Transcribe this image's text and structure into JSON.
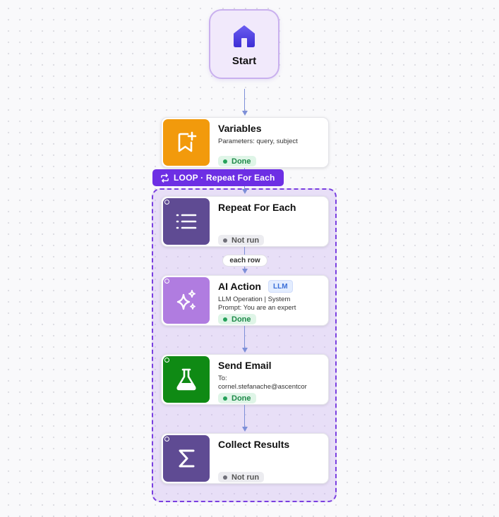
{
  "start": {
    "label": "Start",
    "icon": "home-icon"
  },
  "loop": {
    "tab_label": "LOOP · Repeat For Each",
    "icon": "repeat-icon"
  },
  "edge_label": "each row",
  "nodes": [
    {
      "id": "variables",
      "title": "Variables",
      "desc": "Parameters: query, subject",
      "status": "Done",
      "icon": "bookmark-plus-icon",
      "color": "#f29a0c"
    },
    {
      "id": "repeat",
      "title": "Repeat For Each",
      "desc": "",
      "status": "Not run",
      "icon": "list-icon",
      "color": "#5f4b93"
    },
    {
      "id": "ai",
      "title": "AI Action",
      "tag": "LLM",
      "desc_line1": "LLM Operation | System",
      "desc_line2": "Prompt: You are an expert",
      "status": "Done",
      "icon": "sparkles-icon",
      "color": "#b07ce0"
    },
    {
      "id": "email",
      "title": "Send Email",
      "desc_line1": "To:",
      "desc_line2": "cornel.stefanache@ascentcor",
      "status": "Done",
      "icon": "flask-icon",
      "color": "#0f8a14"
    },
    {
      "id": "collect",
      "title": "Collect Results",
      "desc": "",
      "status": "Not run",
      "icon": "sigma-icon",
      "color": "#5f4b93"
    }
  ]
}
